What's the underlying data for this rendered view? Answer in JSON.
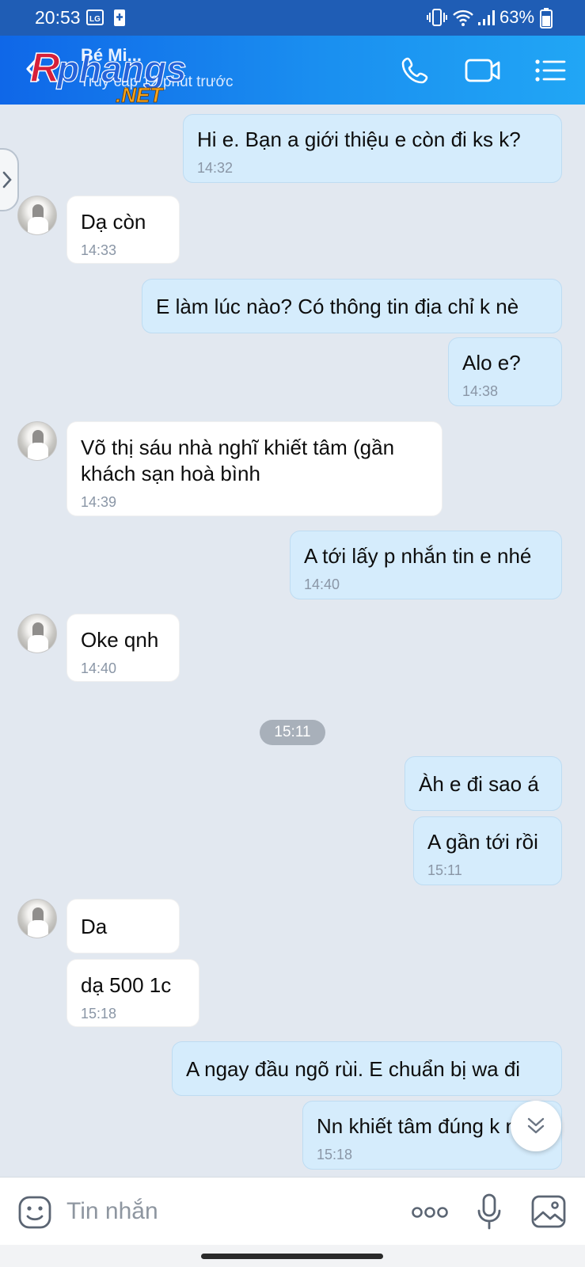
{
  "status_bar": {
    "time": "20:53",
    "battery_percent": "63%"
  },
  "header": {
    "contact_name": "Bé Mi...",
    "last_seen": "Truy cập 12 phút trước",
    "watermark_main": "Rphangs",
    "watermark_sub": ".NET"
  },
  "chat": {
    "separator_time": "15:11",
    "messages": [
      {
        "dir": "out",
        "text": "Hi e. Bạn a giới thiệu e còn đi ks k?",
        "time": "14:32"
      },
      {
        "dir": "in",
        "text": "Dạ còn",
        "time": "14:33"
      },
      {
        "dir": "out",
        "text": "E làm lúc nào? Có thông tin địa chỉ k nè",
        "time": ""
      },
      {
        "dir": "out",
        "text": "Alo e?",
        "time": "14:38"
      },
      {
        "dir": "in",
        "text": "Võ thị sáu nhà nghĩ khiết tâm (gần",
        "text2": "khách sạn hoà bình",
        "time": "14:39"
      },
      {
        "dir": "out",
        "text": "A tới lấy p nhắn tin e nhé",
        "time": "14:40"
      },
      {
        "dir": "in",
        "text": "Oke qnh",
        "time": "14:40"
      },
      {
        "dir": "out",
        "text": "Àh e đi sao á",
        "time": ""
      },
      {
        "dir": "out",
        "text": "A gần tới rồi",
        "time": "15:11"
      },
      {
        "dir": "in",
        "text": "Da",
        "time": ""
      },
      {
        "dir": "in",
        "text": "dạ 500 1c",
        "time": "15:18"
      },
      {
        "dir": "out",
        "text": "A ngay đầu ngõ rùi. E chuẩn bị wa đi",
        "time": ""
      },
      {
        "dir": "out",
        "text": "Nn khiết tâm đúng k nè",
        "time": "15:18"
      }
    ]
  },
  "input": {
    "placeholder": "Tin nhắn"
  },
  "icons": {
    "back": "back-arrow-icon",
    "call": "phone-icon",
    "video": "video-camera-icon",
    "menu": "list-menu-icon",
    "sticker": "smiley-sticker-icon",
    "more": "more-dots-icon",
    "mic": "microphone-icon",
    "gallery": "image-gallery-icon",
    "scroll_down": "double-chevron-down-icon",
    "drawer": "chevron-right-icon"
  },
  "colors": {
    "header_start": "#0f67e8",
    "header_end": "#21a6f5",
    "outgoing_bubble": "#d5ecfc",
    "incoming_bubble": "#ffffff",
    "chat_background": "#e2e8f0"
  }
}
